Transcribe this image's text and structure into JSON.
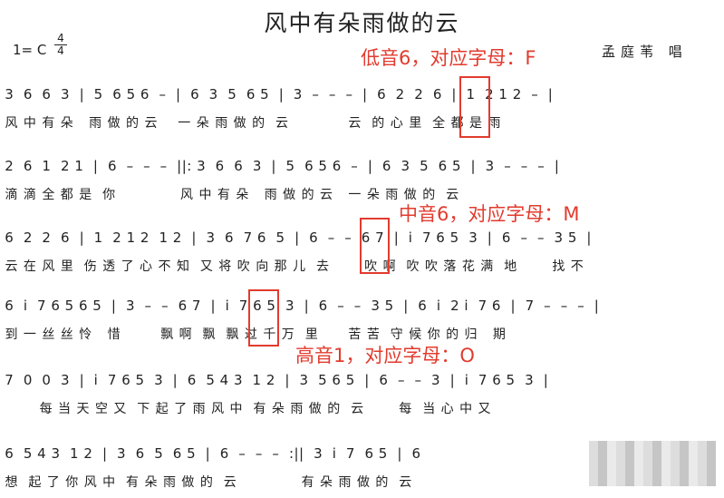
{
  "title": "风中有朵雨做的云",
  "key": "1= C",
  "time_signature": {
    "top": "4",
    "bottom": "4"
  },
  "singer": "孟庭苇 唱",
  "annotations": [
    {
      "text": "低音6，对应字母：F"
    },
    {
      "text": "中音6，对应字母：M"
    },
    {
      "text": "高音1，对应字母：O"
    }
  ],
  "rows": [
    {
      "notes": " 3  6  6  3  |  5  6 5 6  –  |  6  3  5  6 5  |  3  –  –  –  |  6  2  2  6  |  1  2 1 2  –  |",
      "lyrics": " 风 中 有 朵   雨 做 的 云    一 朵 雨 做 的  云            云  的 心 里  全 都 是 雨"
    },
    {
      "notes": " 2  6  1  2 1  |  6  –  –  –  ||: 3  6  6  3  |  5  6 5 6  –  |  6  3  5  6 5  |  3  –  –  –  |",
      "lyrics": " 滴 滴 全 都 是  你             风 中 有 朵   雨 做 的 云   一 朵 雨 做 的  云"
    },
    {
      "notes": " 6  2  2  6  |  1  2 1 2  1 2  |  3  6  7 6  5  |  6  –  –  6 7  |  i  7 6 5  3  |  6  –  –  3 5  |",
      "lyrics": " 云 在 风 里  伤 透 了 心 不 知  又 将 吹 向 那 儿  去       吹 啊  吹 吹 落 花 满  地       找 不"
    },
    {
      "notes": " 6  i  7 6 5 6 5  |  3  –  –  6 7  |  i  7 6 5  3  |  6  –  –  3 5  |  6  i  2 i  7 6  |  7  –  –  –  |",
      "lyrics": " 到 一 丝 丝 怜   惜        飘 啊  飘  飘 过 千 万  里      苦 苦  守 候 你 的 归   期"
    },
    {
      "notes": " 7  0  0  3  |  i  7 6 5  3  |  6  5 4 3  1 2  |  3  5 6 5  |  6  –  –  3  |  i  7 6 5  3  |",
      "lyrics": "        每 当 天 空 又  下 起 了 雨 风 中  有 朵 雨 做 的  云       每  当 心 中 又"
    },
    {
      "notes": " 6  5 4 3  1 2  |  3  6  5  6 5  |  6  –  –  –  :||  3  i  7  6 5  |  6",
      "lyrics": " 想  起 了 你 风 中  有 朵 雨 做 的  云             有 朵 雨 做 的  云"
    }
  ]
}
